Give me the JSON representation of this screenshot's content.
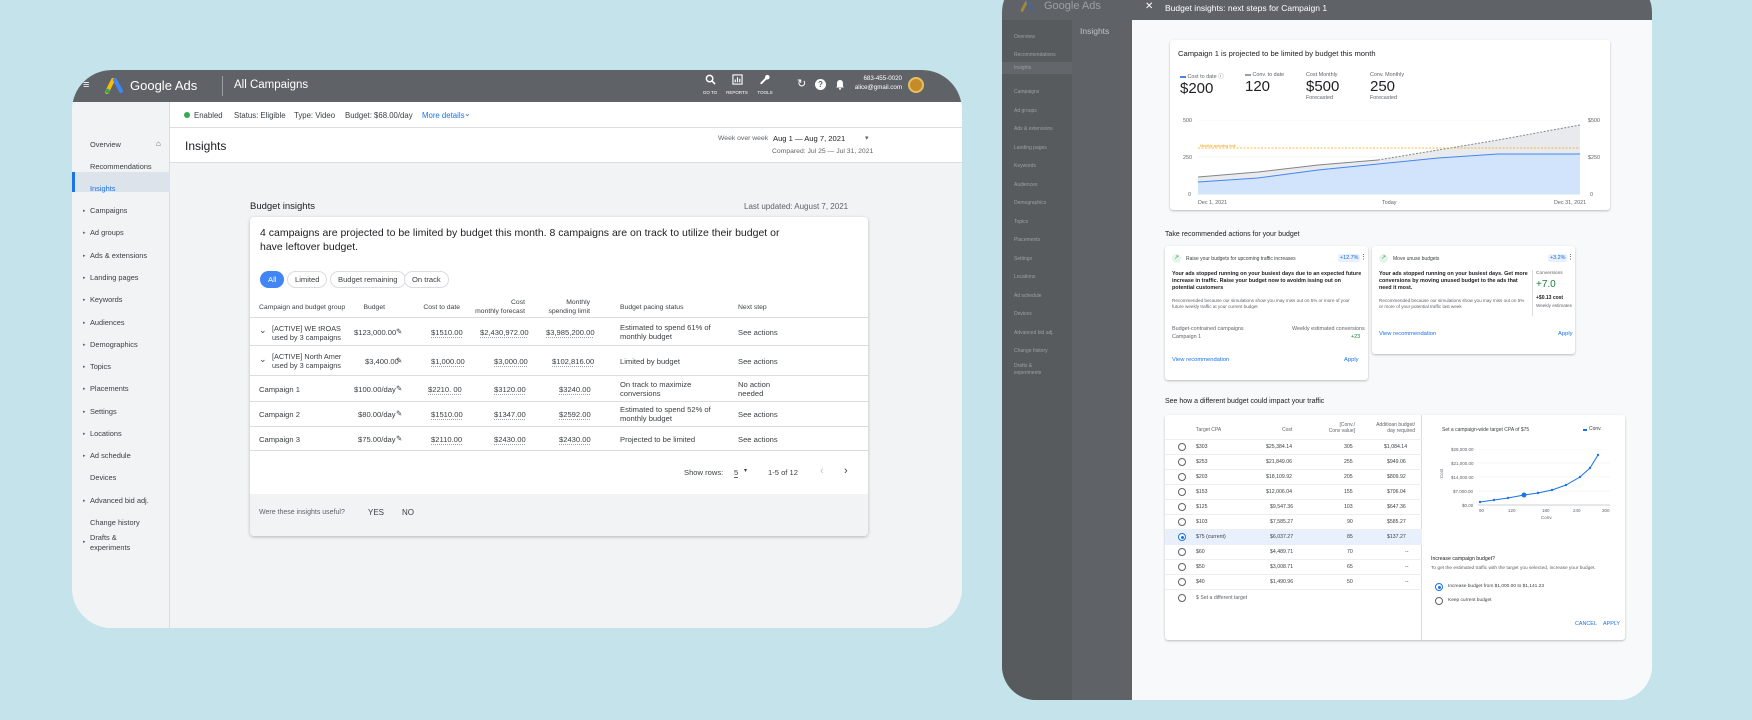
{
  "left": {
    "app_name": "Google Ads",
    "breadcrumb": "All Campaigns",
    "tools": {
      "search": "GO TO",
      "reports": "REPORTS",
      "tools": "TOOLS"
    },
    "phone": "683-455-0020",
    "email": "alice@gmail.com",
    "sidebar": [
      "Overview",
      "Recommendations",
      "Insights",
      "Campaigns",
      "Ad groups",
      "Ads & extensions",
      "Landing pages",
      "Keywords",
      "Audiences",
      "Demographics",
      "Topics",
      "Placements",
      "Settings",
      "Locations",
      "Ad schedule",
      "Devices",
      "Advanced bid adj.",
      "Change history",
      "Drafts &",
      "experiments"
    ],
    "status": {
      "enabled": "Enabled",
      "status": "Status: Eligible",
      "type": "Type: Video",
      "budget": "Budget: $68.00/day",
      "more": "More details"
    },
    "page_title": "Insights",
    "range_label": "Week over week",
    "range": "Aug 1 — Aug 7, 2021",
    "compared": "Compared: Jul 25 — Jul 31, 2021",
    "section_title": "Budget insights",
    "last_updated": "Last updated: August 7, 2021",
    "headline": "4 campaigns are projected to be limited by budget this month. 8 campaigns are on track to utilize their budget or have leftover budget.",
    "chips": [
      "All",
      "Limited",
      "Budget remaining",
      "On track"
    ],
    "headers": {
      "group": "Campaign and budget group",
      "budget": "Budget",
      "cost": "Cost to date",
      "forecast1": "Cost",
      "forecast2": "monthly forecast",
      "limit1": "Monthly",
      "limit2": "spending limit",
      "pacing": "Budget pacing status",
      "next": "Next step"
    },
    "rows": [
      {
        "name": "[ACTIVE] WE tROAS",
        "sub": "used by 3 campaigns",
        "budget": "$123,000.00",
        "cost": "$1510.00",
        "forecast": "$2,430,972.00",
        "limit": "$3,985,200.00",
        "pacing": "Estimated to spend 61% of",
        "pacing2": "monthly budget",
        "next": "See actions",
        "next2": ""
      },
      {
        "name": "[ACTIVE] North Amer",
        "sub": "used by 3 campaigns",
        "budget": "$3,400.00",
        "cost": "$1,000.00",
        "forecast": "$3,000.00",
        "limit": "$102,816.00",
        "pacing": "Limited by budget",
        "pacing2": "",
        "next": "See actions",
        "next2": ""
      },
      {
        "name": "Campaign 1",
        "sub": "",
        "budget": "$100.00/day",
        "cost": "$2210. 00",
        "forecast": "$3120.00",
        "limit": "$3240.00",
        "pacing": "On track to maximize",
        "pacing2": "conversions",
        "next": "No action",
        "next2": "needed"
      },
      {
        "name": "Campaign 2",
        "sub": "",
        "budget": "$80.00/day",
        "cost": "$1510.00",
        "forecast": "$1347.00",
        "limit": "$2592.00",
        "pacing": "Estimated to spend 52% of",
        "pacing2": "monthly budget",
        "next": "See actions",
        "next2": ""
      },
      {
        "name": "Campaign 3",
        "sub": "",
        "budget": "$75.00/day",
        "cost": "$2110.00",
        "forecast": "$2430.00",
        "limit": "$2430.00",
        "pacing": "Projected to be limited",
        "pacing2": "",
        "next": "See actions",
        "next2": ""
      }
    ],
    "show_rows_label": "Show rows:",
    "show_rows_value": "5",
    "pagination": "1-5 of 12",
    "feedback_q": "Were these insights useful?",
    "yes": "YES",
    "no": "NO"
  },
  "right": {
    "app_name": "Google Ads",
    "tab": "Insights",
    "drawer_title": "Budget insights: next steps for Campaign 1",
    "sidebar": [
      "Overview",
      "Recommendations",
      "Insights",
      "Campaigns",
      "Ad groups",
      "Ads & extensions",
      "Landing pages",
      "Keywords",
      "Audiences",
      "Demographics",
      "Topics",
      "Placements",
      "Settings",
      "Locations",
      "Ad schedule",
      "Devices",
      "Advanced bid adj.",
      "Change history",
      "Drafts &",
      "experiments"
    ],
    "projection_title": "Campaign 1 is projected to be limited by budget this month",
    "stats": [
      {
        "label": "Cost to date",
        "value": "$200",
        "sub": ""
      },
      {
        "label": "Conv. to date",
        "value": "120",
        "sub": ""
      },
      {
        "label": "Cost Monthly",
        "value": "$500",
        "sub": "Forecasted"
      },
      {
        "label": "Conv. Monthly",
        "value": "250",
        "sub": "Forecasted"
      }
    ],
    "chart_labels": {
      "y_left": [
        "500",
        "250",
        "0"
      ],
      "y_right": [
        "$500",
        "$250",
        "0"
      ],
      "x": [
        "Dec 1, 2021",
        "Today",
        "Dec 31, 2021"
      ],
      "budget_line": "Monthly spending limit"
    },
    "recs_title": "Take recommended actions for your budget",
    "rec1": {
      "title": "Raise your budgets for upcoming traffic increases",
      "badge": "+12.7%",
      "body": "Your ads stopped running on your busiest days due to an expected future increase in traffic. Raise your budget now to avoidm issing out on potential customers",
      "note": "Recommended because our simulations show you may miss out on 5% or more of your future weekly traffic at your current budget",
      "col1": "Budget-contrained campaigns",
      "col2": "Weekly estimated conversions",
      "camp": "Campaign 1",
      "val": "+23",
      "view": "View recommendation",
      "apply": "Apply"
    },
    "rec2": {
      "title": "Move unuse budgets",
      "badge": "+3.2%",
      "body": "Your ads stopped running on your busiest days. Get more conversions by moving unused budget to the ads that need it most.",
      "note": "Recommended because our simulations show you may miss out on 5% or more of your potential traffic last week",
      "conv_label": "Conversions",
      "conv": "+7.0",
      "cost": "+$0.13 cost",
      "cost_sub": "Weekly estimates",
      "view": "View recommendation",
      "apply": "Apply"
    },
    "sim_title": "See how a different budget could impact your traffic",
    "sim_headers": {
      "cpa": "Target CPA",
      "cost": "Cost",
      "conv1": "[Conv./",
      "conv2": "Conv value]",
      "add1": "Additioan budget/",
      "add2": "day required"
    },
    "sim_rows": [
      {
        "cpa": "$303",
        "cost": "$25,384.14",
        "conv": "305",
        "add": "$1,084.14"
      },
      {
        "cpa": "$253",
        "cost": "$21,849.06",
        "conv": "255",
        "add": "$949.06"
      },
      {
        "cpa": "$203",
        "cost": "$18,109.92",
        "conv": "205",
        "add": "$809.92"
      },
      {
        "cpa": "$153",
        "cost": "$12,006.04",
        "conv": "155",
        "add": "$706.04"
      },
      {
        "cpa": "$125",
        "cost": "$9,547.36",
        "conv": "103",
        "add": "$647.36"
      },
      {
        "cpa": "$103",
        "cost": "$7,585.27",
        "conv": "90",
        "add": "$585.27"
      },
      {
        "cpa": "$75 (current)",
        "cost": "$6,037.27",
        "conv": "85",
        "add": "$137.27"
      },
      {
        "cpa": "$60",
        "cost": "$4,489.71",
        "conv": "70",
        "add": "--"
      },
      {
        "cpa": "$50",
        "cost": "$3,008.71",
        "conv": "65",
        "add": "--"
      },
      {
        "cpa": "$40",
        "cost": "$1,490.96",
        "conv": "50",
        "add": "--"
      }
    ],
    "sim_other": "$ Set a different target",
    "sim_chart_title": "Set a campaign-wide target CPA of $75",
    "sim_legend": "Conv.",
    "sim_y": [
      "$28,000.00",
      "$21,000.00",
      "$14,000.00",
      "$7,000.00",
      "$0.00"
    ],
    "sim_x": [
      "90",
      "120",
      "180",
      "240",
      "300"
    ],
    "sim_ylabel": "Cost",
    "sim_xlabel": "Conv.",
    "increase_title": "Increase campaign budget?",
    "increase_body": "To get the estimated traffic with the target you selected, increase your budget.",
    "opt1": "Increase budget from $1,000.00 to $1,141.23",
    "opt2": "Keep current budget",
    "cancel": "CANCEL",
    "apply": "APPLY"
  }
}
